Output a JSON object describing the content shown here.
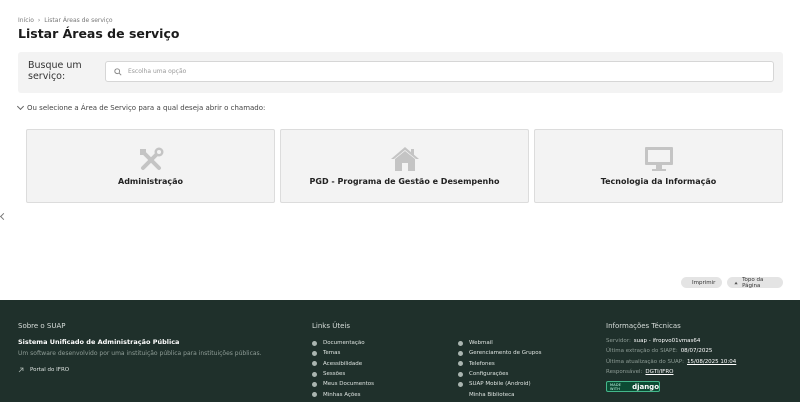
{
  "breadcrumb": {
    "home": "Início",
    "separator": "›",
    "current": "Listar Áreas de serviço"
  },
  "page": {
    "title": "Listar Áreas de serviço"
  },
  "search": {
    "label": "Busque um serviço:",
    "placeholder": "Escolha uma opção"
  },
  "select_hint": "Ou selecione a Área de Serviço para a qual deseja abrir o chamado:",
  "cards": [
    {
      "label": "Administração",
      "icon": "tools-icon"
    },
    {
      "label": "PGD - Programa de Gestão e Desempenho",
      "icon": "home-icon"
    },
    {
      "label": "Tecnologia da Informação",
      "icon": "monitor-icon"
    }
  ],
  "actions": {
    "print": "Imprimir",
    "top": "Topo da Página"
  },
  "footer": {
    "about": {
      "heading": "Sobre o SUAP",
      "title": "Sistema Unificado de Administração Pública",
      "description": "Um software desenvolvido por uma instituição pública para instituições públicas.",
      "portal": "Portal do IFRO"
    },
    "links": {
      "heading": "Links Úteis",
      "col1": [
        "Documentação",
        "Temas",
        "Acessibilidade",
        "Sessões",
        "Meus Documentos",
        "Minhas Ações"
      ],
      "col2": [
        "Webmail",
        "Gerenciamento de Grupos",
        "Telefones",
        "Configurações",
        "SUAP Mobile (Android)",
        "Minha Biblioteca"
      ]
    },
    "tech": {
      "heading": "Informações Técnicas",
      "server_label": "Servidor:",
      "server_value": "suap - ifropvo01vmas64",
      "siape_label": "Última extração do SIAPE:",
      "siape_value": "08/07/2025",
      "update_label": "Última atualização do SUAP:",
      "update_value": "15/08/2025 10:04",
      "resp_label": "Responsável:",
      "resp_value": "DGTI/IFRO",
      "badge_made": "MADE WITH",
      "badge_brand": "django"
    }
  },
  "colors": {
    "footer_bg": "#1f302b",
    "card_bg": "#f3f3f3",
    "icon_gray": "#c4c4c4"
  }
}
